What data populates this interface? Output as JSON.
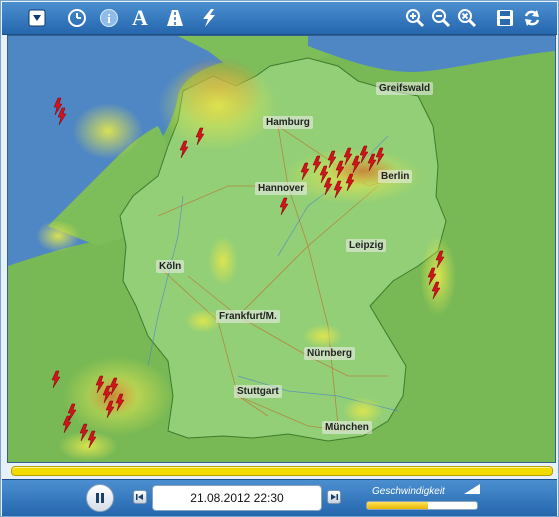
{
  "toolbar": {
    "left_icons": [
      "menu-dropdown-icon",
      "clock-icon",
      "info-icon",
      "font-size-icon",
      "highway-icon",
      "lightning-icon"
    ],
    "right_icons": [
      "zoom-in-icon",
      "zoom-out-icon",
      "zoom-reset-icon",
      "save-icon",
      "refresh-icon"
    ],
    "font_glyph": "A",
    "info_glyph": "i"
  },
  "map": {
    "cities": [
      {
        "id": "greifswald",
        "name": "Greifswald"
      },
      {
        "id": "hamburg",
        "name": "Hamburg"
      },
      {
        "id": "hannover",
        "name": "Hannover"
      },
      {
        "id": "berlin",
        "name": "Berlin"
      },
      {
        "id": "leipzig",
        "name": "Leipzig"
      },
      {
        "id": "koeln",
        "name": "Köln"
      },
      {
        "id": "frankfurt",
        "name": "Frankfurt/M."
      },
      {
        "id": "nuernberg",
        "name": "Nürnberg"
      },
      {
        "id": "stuttgart",
        "name": "Stuttgart"
      },
      {
        "id": "muenchen",
        "name": "München"
      }
    ],
    "colors": {
      "sea": "#4f87c4",
      "land": "#7cbf5a",
      "germany": "#95cf79",
      "precip_light": "#d8e34a",
      "precip_heavy": "#c98b3a",
      "lightning": "#d4121a"
    }
  },
  "playback": {
    "progress": 1.0,
    "timestamp": "21.08.2012 22:30",
    "speed_label": "Geschwindigkeit",
    "speed_level": 0.55,
    "playing": true
  }
}
